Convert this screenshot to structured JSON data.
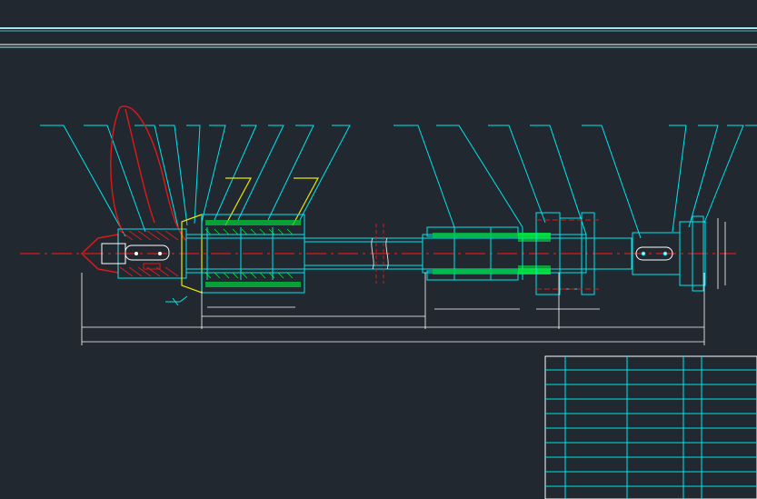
{
  "drawing": {
    "type": "cad-assembly-drawing",
    "subject": "shaft-assembly",
    "background_color": "#212830",
    "colors": {
      "outline": "#00e5ee",
      "border": "#9fe7ee",
      "centerline": "#e01818",
      "hatch": "#e02020",
      "highlight": "#00ff40",
      "leader": "#ffff00",
      "dimension": "#ffffff"
    },
    "leader_count_top": 18,
    "title_block": {
      "columns": 5,
      "rows": 9,
      "text": []
    }
  }
}
